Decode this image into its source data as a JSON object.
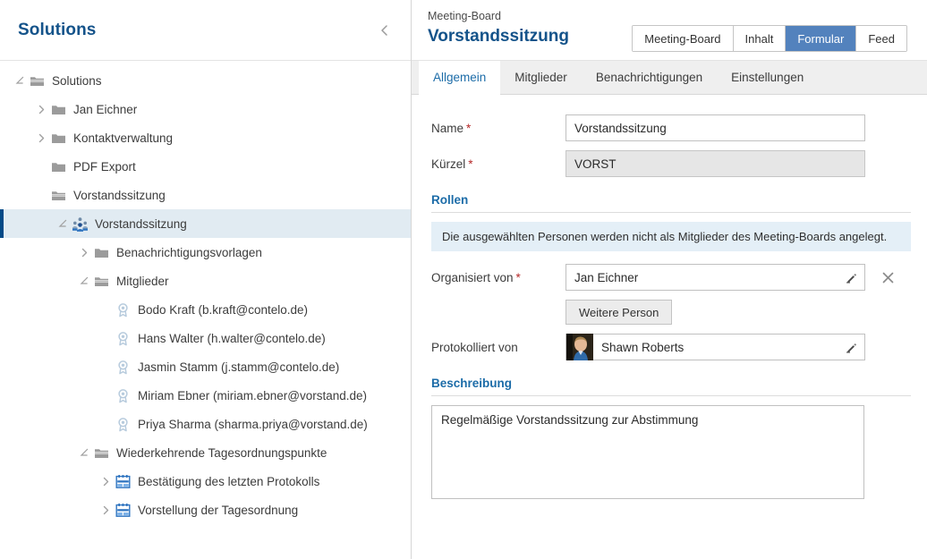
{
  "sidebar": {
    "title": "Solutions",
    "collapse_icon": "chevron-left-icon",
    "tree": [
      {
        "label": "Solutions",
        "depth": 0,
        "twisty": "expanded",
        "icon": "folder-open-icon",
        "selected": false
      },
      {
        "label": "Jan Eichner",
        "depth": 1,
        "twisty": "collapsed",
        "icon": "folder-icon",
        "selected": false
      },
      {
        "label": "Kontaktverwaltung",
        "depth": 1,
        "twisty": "collapsed",
        "icon": "folder-icon",
        "selected": false
      },
      {
        "label": "PDF Export",
        "depth": 1,
        "twisty": "none",
        "icon": "folder-icon",
        "selected": false
      },
      {
        "label": "Vorstandssitzung",
        "depth": 1,
        "twisty": "none",
        "icon": "folder-open-icon",
        "selected": false
      },
      {
        "label": "Vorstandssitzung",
        "depth": 2,
        "twisty": "expanded",
        "icon": "meeting-board-icon",
        "selected": true
      },
      {
        "label": "Benachrichtigungsvorlagen",
        "depth": 3,
        "twisty": "collapsed",
        "icon": "folder-icon",
        "selected": false
      },
      {
        "label": "Mitglieder",
        "depth": 3,
        "twisty": "expanded",
        "icon": "folder-open-icon",
        "selected": false
      },
      {
        "label": "Bodo Kraft (b.kraft@contelo.de)",
        "depth": 4,
        "twisty": "none",
        "icon": "member-badge-icon",
        "selected": false
      },
      {
        "label": "Hans Walter (h.walter@contelo.de)",
        "depth": 4,
        "twisty": "none",
        "icon": "member-badge-icon",
        "selected": false
      },
      {
        "label": "Jasmin Stamm (j.stamm@contelo.de)",
        "depth": 4,
        "twisty": "none",
        "icon": "member-badge-icon",
        "selected": false
      },
      {
        "label": "Miriam Ebner (miriam.ebner@vorstand.de)",
        "depth": 4,
        "twisty": "none",
        "icon": "member-badge-icon",
        "selected": false
      },
      {
        "label": "Priya Sharma (sharma.priya@vorstand.de)",
        "depth": 4,
        "twisty": "none",
        "icon": "member-badge-icon",
        "selected": false
      },
      {
        "label": "Wiederkehrende Tagesordnungspunkte",
        "depth": 3,
        "twisty": "expanded",
        "icon": "folder-open-icon",
        "selected": false
      },
      {
        "label": "Bestätigung des letzten Protokolls",
        "depth": 4,
        "twisty": "collapsed",
        "icon": "calendar-icon",
        "selected": false
      },
      {
        "label": "Vorstellung der Tagesordnung",
        "depth": 4,
        "twisty": "collapsed",
        "icon": "calendar-icon",
        "selected": false
      }
    ]
  },
  "header": {
    "breadcrumb": "Meeting-Board",
    "title": "Vorstandssitzung",
    "view_buttons": [
      {
        "label": "Meeting-Board",
        "active": false
      },
      {
        "label": "Inhalt",
        "active": false
      },
      {
        "label": "Formular",
        "active": true
      },
      {
        "label": "Feed",
        "active": false
      }
    ]
  },
  "tabs": [
    {
      "label": "Allgemein",
      "active": true
    },
    {
      "label": "Mitglieder",
      "active": false
    },
    {
      "label": "Benachrichtigungen",
      "active": false
    },
    {
      "label": "Einstellungen",
      "active": false
    }
  ],
  "form": {
    "name": {
      "label": "Name",
      "required": true,
      "value": "Vorstandssitzung",
      "readonly": false
    },
    "kuerzel": {
      "label": "Kürzel",
      "required": true,
      "value": "VORST",
      "readonly": true
    },
    "rollen_section": "Rollen",
    "rollen_info": "Die ausgewählten Personen werden nicht als Mitglieder des Meeting-Boards angelegt.",
    "organisiert_von": {
      "label": "Organisiert von",
      "required": true,
      "value": "Jan Eichner",
      "edit_icon": "pencil-icon",
      "clear_icon": "close-icon"
    },
    "weitere_person_button": "Weitere Person",
    "protokolliert_von": {
      "label": "Protokolliert von",
      "required": false,
      "value": "Shawn Roberts",
      "avatar": "person-photo-avatar",
      "edit_icon": "pencil-icon"
    },
    "beschreibung_section": "Beschreibung",
    "beschreibung_value": "Regelmäßige Vorstandssitzung zur Abstimmung"
  },
  "colors": {
    "brand_blue": "#14538a",
    "accent_blue": "#5382bd",
    "tab_active_text": "#1c6ca8",
    "selection_bg": "#e1ebf2",
    "selection_bar": "#034a87",
    "info_bg": "#e4eff7",
    "required_red": "#b62a2a"
  }
}
